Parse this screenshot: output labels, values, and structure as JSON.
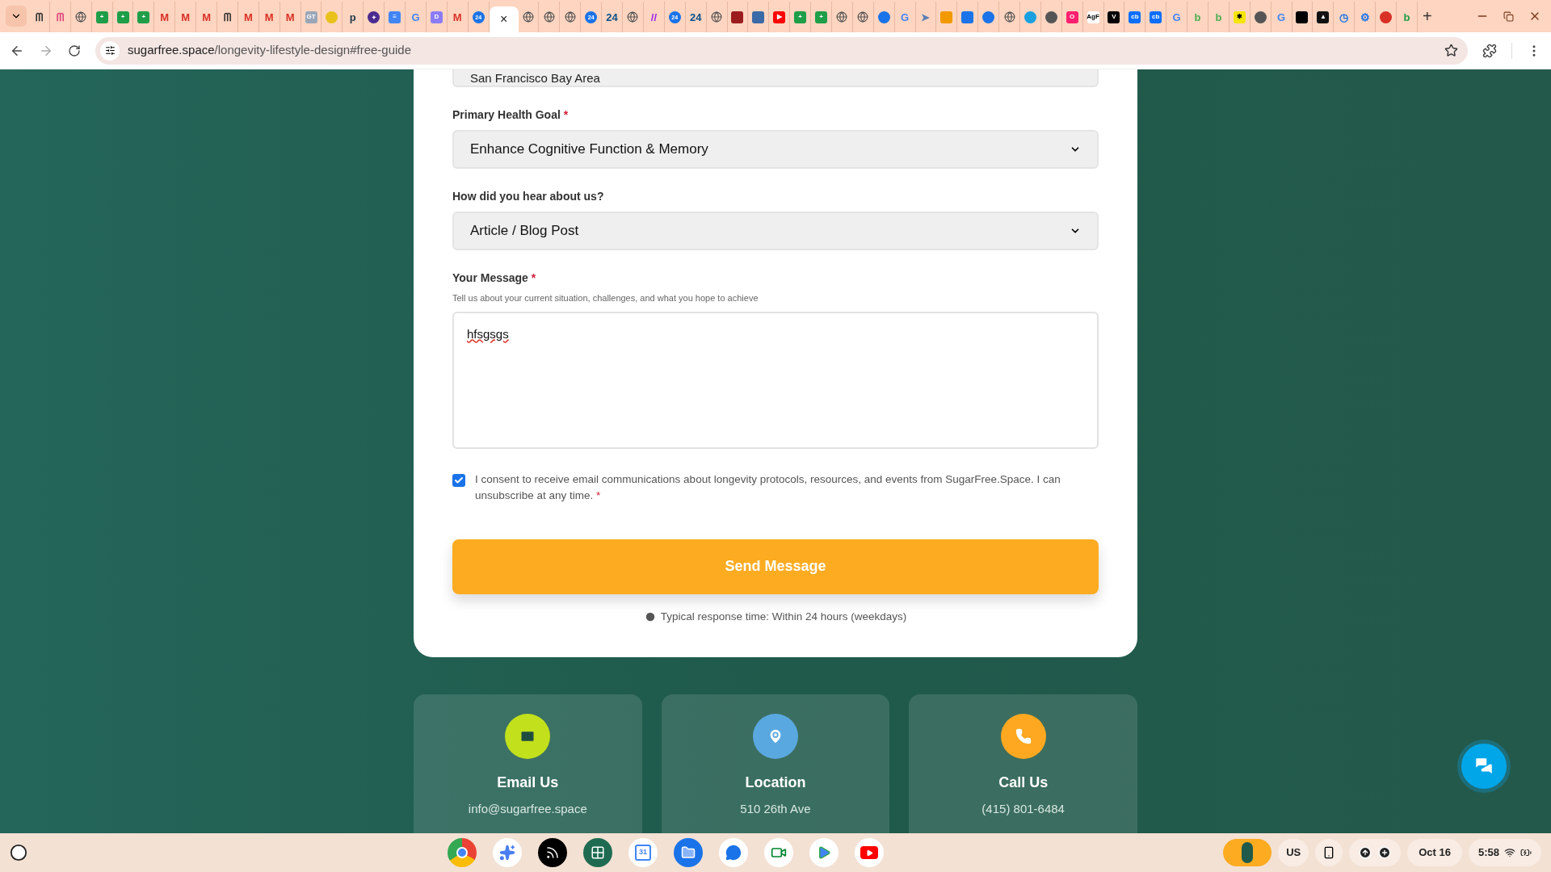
{
  "tabs": [
    {
      "kind": "glyph",
      "text": "ᗰ",
      "color": "#333333",
      "selected": false
    },
    {
      "kind": "glyph",
      "text": "ᗰ",
      "color": "#e0457b",
      "selected": false
    },
    {
      "kind": "globe",
      "color": "#555555",
      "selected": false
    },
    {
      "kind": "square",
      "text": "+",
      "color": "#1e9e48",
      "selected": false
    },
    {
      "kind": "square",
      "text": "+",
      "color": "#1e9e48",
      "selected": false
    },
    {
      "kind": "square",
      "text": "+",
      "color": "#1e9e48",
      "selected": false
    },
    {
      "kind": "glyph",
      "text": "M",
      "color": "#d93025",
      "selected": false
    },
    {
      "kind": "glyph",
      "text": "M",
      "color": "#d93025",
      "selected": false
    },
    {
      "kind": "glyph",
      "text": "M",
      "color": "#d93025",
      "selected": false
    },
    {
      "kind": "glyph",
      "text": "ᗰ",
      "color": "#333333",
      "selected": false
    },
    {
      "kind": "glyph",
      "text": "M",
      "color": "#d93025",
      "selected": false
    },
    {
      "kind": "glyph",
      "text": "M",
      "color": "#d93025",
      "selected": false
    },
    {
      "kind": "glyph",
      "text": "M",
      "color": "#d93025",
      "selected": false
    },
    {
      "kind": "square",
      "text": "GT",
      "color": "#9aa7b8",
      "selected": false
    },
    {
      "kind": "circle",
      "color": "#e8c21a",
      "selected": false
    },
    {
      "kind": "glyph",
      "text": "p",
      "color": "#1f3a4d",
      "selected": false
    },
    {
      "kind": "circle",
      "text": "✦",
      "color": "#4b2a8f",
      "selected": false
    },
    {
      "kind": "square",
      "text": "≡",
      "color": "#4285f4",
      "selected": false
    },
    {
      "kind": "glyph",
      "text": "G",
      "color": "#4285f4",
      "selected": false
    },
    {
      "kind": "square",
      "text": "D",
      "color": "#8b7cf6",
      "selected": false
    },
    {
      "kind": "glyph",
      "text": "M",
      "color": "#d93025",
      "selected": false
    },
    {
      "kind": "circle",
      "text": "24",
      "color": "#1a73e8",
      "selected": false
    },
    {
      "text": "×",
      "selected": true
    },
    {
      "kind": "globe",
      "color": "#555555",
      "selected": false
    },
    {
      "kind": "globe",
      "color": "#555555",
      "selected": false
    },
    {
      "kind": "globe",
      "color": "#555555",
      "selected": false
    },
    {
      "kind": "circle",
      "text": "24",
      "color": "#1a73e8",
      "selected": false
    },
    {
      "kind": "glyph",
      "text": "24",
      "color": "#0b4f8a",
      "selected": false
    },
    {
      "kind": "globe",
      "color": "#555555",
      "selected": false
    },
    {
      "kind": "glyph",
      "text": "//",
      "color": "#a020f0",
      "selected": false
    },
    {
      "kind": "circle",
      "text": "24",
      "color": "#1a73e8",
      "selected": false
    },
    {
      "kind": "glyph",
      "text": "24",
      "color": "#0b4f8a",
      "selected": false
    },
    {
      "kind": "globe",
      "color": "#555555",
      "selected": false
    },
    {
      "kind": "square",
      "color": "#9b1c1c",
      "selected": false
    },
    {
      "kind": "square",
      "color": "#3b6aa8",
      "selected": false
    },
    {
      "kind": "square",
      "text": "▶",
      "color": "#ff0000",
      "selected": false
    },
    {
      "kind": "square",
      "text": "+",
      "color": "#1e9e48",
      "selected": false
    },
    {
      "kind": "square",
      "text": "+",
      "color": "#1e9e48",
      "selected": false
    },
    {
      "kind": "globe",
      "color": "#555555",
      "selected": false
    },
    {
      "kind": "globe",
      "color": "#555555",
      "selected": false
    },
    {
      "kind": "circle",
      "color": "#1a73e8",
      "selected": false
    },
    {
      "kind": "glyph",
      "text": "G",
      "color": "#4285f4",
      "selected": false
    },
    {
      "kind": "glyph",
      "text": "➤",
      "color": "#5a7fb5",
      "selected": false
    },
    {
      "kind": "square",
      "color": "#f29900",
      "selected": false
    },
    {
      "kind": "square",
      "color": "#1a73e8",
      "selected": false
    },
    {
      "kind": "circle",
      "color": "#1a73e8",
      "selected": false
    },
    {
      "kind": "globe",
      "color": "#555555",
      "selected": false
    },
    {
      "kind": "circle",
      "color": "#1aa0e0",
      "selected": false
    },
    {
      "kind": "circle",
      "color": "#555555",
      "selected": false
    },
    {
      "kind": "square",
      "text": "O",
      "color": "#ff1f6e",
      "selected": false
    },
    {
      "kind": "square",
      "text": "AgF",
      "color": "#ffffff",
      "selected": false
    },
    {
      "kind": "square",
      "text": "V",
      "color": "#000000",
      "selected": false
    },
    {
      "kind": "square",
      "text": "cb",
      "color": "#0e6fff",
      "selected": false
    },
    {
      "kind": "square",
      "text": "cb",
      "color": "#0e6fff",
      "selected": false
    },
    {
      "kind": "glyph",
      "text": "G",
      "color": "#4285f4",
      "selected": false
    },
    {
      "kind": "glyph",
      "text": "b",
      "color": "#4caf50",
      "selected": false
    },
    {
      "kind": "glyph",
      "text": "b",
      "color": "#4caf50",
      "selected": false
    },
    {
      "kind": "square",
      "text": "✱",
      "color": "#f5e50a",
      "selected": false
    },
    {
      "kind": "circle",
      "color": "#555555",
      "selected": false
    },
    {
      "kind": "glyph",
      "text": "G",
      "color": "#4285f4",
      "selected": false
    },
    {
      "kind": "square",
      "color": "#000000",
      "selected": false
    },
    {
      "kind": "square",
      "text": "▲",
      "color": "#111111",
      "selected": false
    },
    {
      "kind": "glyph",
      "text": "◷",
      "color": "#1a73e8",
      "selected": false
    },
    {
      "kind": "glyph",
      "text": "⚙",
      "color": "#1a73e8",
      "selected": false
    },
    {
      "kind": "circle",
      "color": "#d93025",
      "selected": false
    },
    {
      "kind": "glyph",
      "text": "b",
      "color": "#1e9e48",
      "selected": false
    }
  ],
  "new_tab": "+",
  "address_bar": {
    "domain": "sugarfree.space",
    "path": "/longevity-lifestyle-design#free-guide"
  },
  "form": {
    "required_mark": "*",
    "cut_field_value": "San Francisco Bay Area",
    "fields": [
      {
        "kind": "select",
        "label": "Primary Health Goal",
        "required": true,
        "value": "Enhance Cognitive Function & Memory"
      },
      {
        "kind": "select",
        "label": "How did you hear about us?",
        "required": false,
        "value": "Article / Blog Post"
      },
      {
        "kind": "textarea",
        "label": "Your Message",
        "required": true,
        "hint": "Tell us about your current situation, challenges, and what you hope to achieve",
        "value": "hfsgsgs"
      }
    ],
    "consent": {
      "checked": true,
      "text": "I consent to receive email communications about longevity protocols, resources, and events from SugarFree.Space. I can unsubscribe at any time.",
      "required": true
    },
    "submit": "Send Message",
    "response_note": "Typical response time: Within 24 hours (weekdays)"
  },
  "contact_cards": [
    {
      "kind": "email",
      "title": "Email Us",
      "value": "info@sugarfree.space",
      "color": "#c2e01b"
    },
    {
      "kind": "location",
      "title": "Location",
      "value": "510 26th Ave",
      "color": "#5aa8e0"
    },
    {
      "kind": "phone",
      "title": "Call Us",
      "value": "(415) 801-6484",
      "color": "#fda820"
    }
  ],
  "taskbar": {
    "apps": [
      {
        "kind": "chrome"
      },
      {
        "kind": "gemini"
      },
      {
        "kind": "podcast"
      },
      {
        "kind": "apps"
      },
      {
        "kind": "calendar"
      },
      {
        "kind": "files"
      },
      {
        "kind": "messages"
      },
      {
        "kind": "meet"
      },
      {
        "kind": "play"
      },
      {
        "kind": "youtube"
      }
    ],
    "calendar_day": "31",
    "input": "US",
    "date": "Oct 16",
    "time": "5:58"
  }
}
